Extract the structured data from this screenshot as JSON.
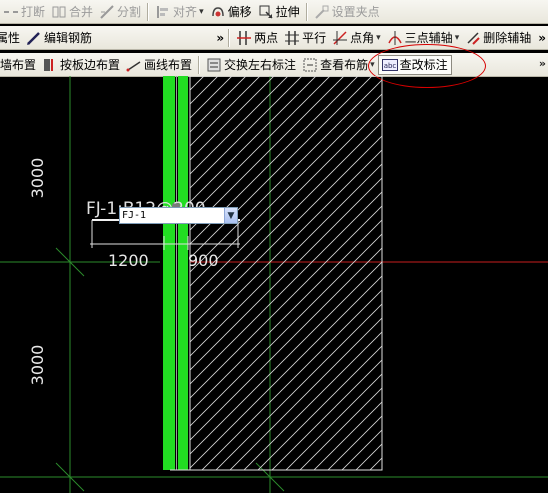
{
  "toolbar1": {
    "break_label": "打断",
    "merge_label": "合并",
    "split_label": "分割",
    "align_label": "对齐",
    "offset_label": "偏移",
    "stretch_label": "拉伸",
    "set_grip_label": "设置夹点"
  },
  "toolbar2": {
    "attr_label": "属性",
    "edit_rebar_label": "编辑钢筋",
    "two_point_label": "两点",
    "parallel_label": "平行",
    "point_angle_label": "点角",
    "three_point_axis_label": "三点辅轴",
    "delete_axis_label": "删除辅轴",
    "more_label": "»"
  },
  "toolbar3": {
    "by_wall_label": "按墙布置",
    "by_slab_edge_label": "按板边布置",
    "draw_line_label": "画线布置",
    "swap_label_label": "交换左右标注",
    "view_rebar_label": "查看布筋",
    "edit_label_label": "查改标注",
    "more_label": "»"
  },
  "canvas": {
    "dim_top": "3000",
    "dim_bottom": "3000",
    "rebar_label": "FJ-1:B12@200",
    "dim_left": "1200",
    "dim_right": "900"
  },
  "edit_box": {
    "value": "FJ-1"
  },
  "colors": {
    "background": "#000000",
    "wall_green": "#22dd22",
    "axis_red": "#c81e1e",
    "axis_green": "#2c8c2c",
    "highlight": "#d60000"
  }
}
